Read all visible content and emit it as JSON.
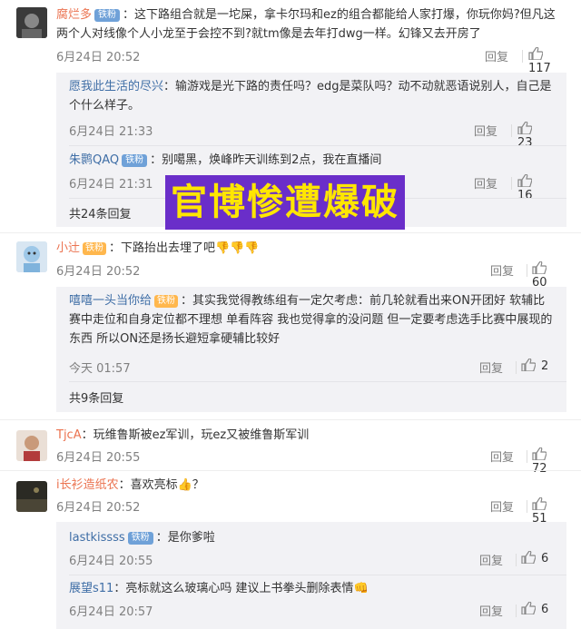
{
  "overlay": {
    "text": "官博惨遭爆破"
  },
  "reply_label": "回复",
  "comments": [
    {
      "user": "腐烂多",
      "badge": "铁粉",
      "text": "：这下路组合就是一坨屎，拿卡尔玛和ez的组合都能给人家打爆，你玩你妈?但凡这两个人对线像个人小龙至于会控不到?就tm像是去年打dwg一样。幻锋又去开房了",
      "time": "6月24日 20:52",
      "likes": "117",
      "replies": [
        {
          "user": "愿我此生活的尽兴",
          "badge": "",
          "text": "：输游戏是光下路的责任吗？edg是菜队吗？动不动就恶语说别人，自己是个什么样子。",
          "time": "6月24日 21:33",
          "likes": "23"
        },
        {
          "user": "朱鹮QAQ",
          "badge": "铁粉",
          "text": "：别噶黑，焕峰昨天训练到2点，我在直播间",
          "time": "6月24日 21:31",
          "likes": "16"
        }
      ],
      "more": "共24条回复"
    },
    {
      "user": "小辻",
      "badge": "铁粉",
      "text": "：下路抬出去埋了吧👎👎👎",
      "time": "6月24日 20:52",
      "likes": "60",
      "replies": [
        {
          "user": "嘻嘻一头当你给",
          "badge": "铁粉",
          "text": "：其实我觉得教练组有一定欠考虑：前几轮就看出来ON开团好 软辅比赛中走位和自身定位都不理想 单看阵容 我也觉得拿的没问题 但一定要考虑选手比赛中展现的东西 所以ON还是扬长避短拿硬辅比较好",
          "time": "今天 01:57",
          "likes": "2"
        }
      ],
      "more": "共9条回复"
    },
    {
      "user": "TjcA",
      "badge": "",
      "text": "：玩维鲁斯被ez军训，玩ez又被维鲁斯军训",
      "time": "6月24日 20:55",
      "likes": "72",
      "replies": []
    },
    {
      "user": "i长衫造纸农",
      "badge": "",
      "text": "：喜欢亮标👍？",
      "time": "6月24日 20:52",
      "likes": "51",
      "replies": [
        {
          "user": "lastkissss",
          "badge": "铁粉",
          "text": "：是你爹啦",
          "time": "6月24日 20:55",
          "likes": "6"
        },
        {
          "user": "展望s11",
          "badge": "",
          "text": "：亮标就这么玻璃心吗 建议上书拳头删除表情👊",
          "time": "6月24日 20:57",
          "likes": "6"
        }
      ]
    }
  ]
}
